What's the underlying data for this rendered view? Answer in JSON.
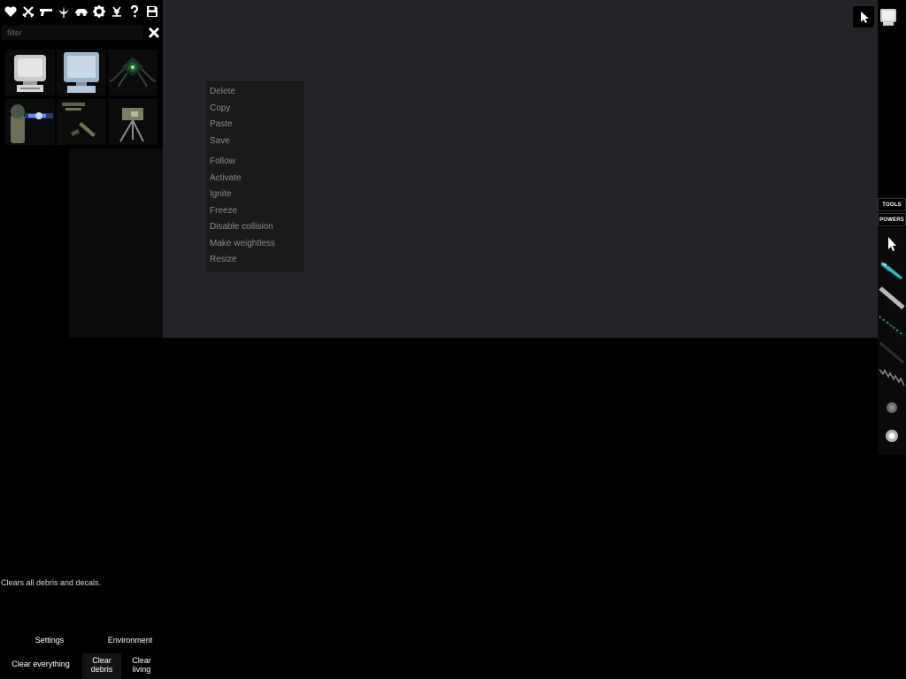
{
  "filter": {
    "placeholder": "filter",
    "value": ""
  },
  "category_icons": [
    "heart-icon",
    "crossed-swords-icon",
    "pistol-icon",
    "cannabis-leaf-icon",
    "vehicle-icon",
    "gear-icon",
    "biohazard-icon",
    "question-icon",
    "save-icon"
  ],
  "items": [
    {
      "icon": "crt-monitor-grey-icon"
    },
    {
      "icon": "crt-monitor-blue-icon"
    },
    {
      "icon": "spider-robot-icon"
    },
    {
      "icon": "plasma-turret-icon"
    },
    {
      "icon": "rifle-parts-icon"
    },
    {
      "icon": "camera-tripod-icon"
    }
  ],
  "context_menu": {
    "items": [
      "Delete",
      "Copy",
      "Paste",
      "Save",
      "Follow",
      "Activate",
      "Ignite",
      "Freeze",
      "Disable collision",
      "Make weightless",
      "Resize"
    ]
  },
  "side_tabs": {
    "tools": "TOOLS",
    "powers": "POWERS"
  },
  "tools": [
    "cursor-icon",
    "cyan-blade-icon",
    "grey-rod-icon",
    "green-dotted-line-icon",
    "dark-rod-icon",
    "zigzag-icon",
    "grey-orb-icon",
    "white-orb-icon"
  ],
  "hint": "Clears all debris and decals.",
  "bottom": {
    "settings": "Settings",
    "environment": "Environment",
    "clear_everything": "Clear everything",
    "clear_debris": "Clear debris",
    "clear_living": "Clear living"
  }
}
